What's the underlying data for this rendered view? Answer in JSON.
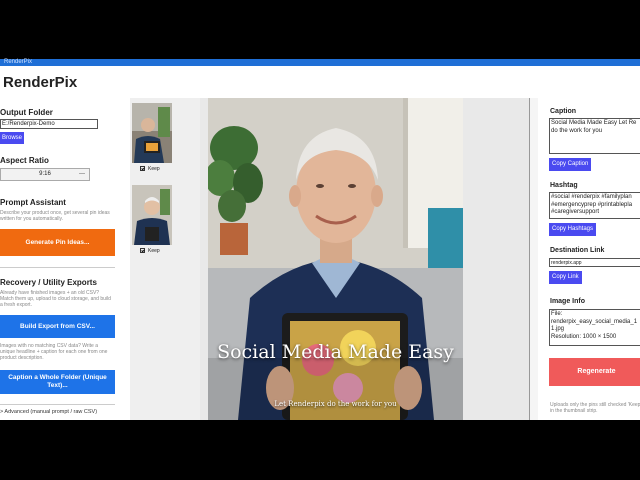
{
  "window": {
    "title_bar_text": "RenderPix",
    "app_title": "RenderPix"
  },
  "left": {
    "output_folder": {
      "label": "Output Folder",
      "path_value": "E:/Renderpix-Demo",
      "browse_label": "Browse"
    },
    "aspect_ratio": {
      "label": "Aspect Ratio",
      "value": "9:16"
    },
    "prompt_assistant": {
      "label": "Prompt Assistant",
      "description": "Describe your product once, get several pin ideas written for you automatically.",
      "generate_label": "Generate Pin Ideas..."
    },
    "recovery": {
      "label": "Recovery / Utility Exports",
      "description_1": "Already have finished images + an old CSV? Match them up, upload to cloud storage, and build a fresh export.",
      "build_export_label": "Build Export from CSV...",
      "description_2": "Images with no matching CSV data? Write a unique headline + caption for each one from one product description.",
      "caption_folder_label": "Caption a Whole Folder (Unique Text)..."
    },
    "advanced_label": "> Advanced (manual prompt / raw CSV)"
  },
  "thumbnails": [
    {
      "keep_label": "Keep",
      "checked": true
    },
    {
      "keep_label": "Keep",
      "checked": true
    }
  ],
  "preview": {
    "headline": "Social Media Made Easy",
    "subline": "Let Renderpix do the work for you"
  },
  "right": {
    "caption": {
      "label": "Caption",
      "value": "Social Media Made Easy Let Re\ndo the work for you",
      "copy_label": "Copy Caption"
    },
    "hashtags": {
      "label": "Hashtag",
      "value": "#social #renderpix #familyplan\n#emergencyprep #printablepla\n#caregiversupport",
      "copy_label": "Copy Hashtags"
    },
    "destination": {
      "label": "Destination Link",
      "value": "renderpix.app",
      "copy_label": "Copy Link"
    },
    "image_info": {
      "label": "Image Info",
      "value": "File:\nrenderpix_easy_social_media_1\n1.jpg\nResolution: 1000 × 1500"
    },
    "regenerate_label": "Regenerate",
    "note": "Uploads only the pins still checked 'Keep' in the thumbnail strip."
  },
  "colors": {
    "accent_blue": "#1e73e8",
    "accent_orange": "#f06a10",
    "regenerate_red": "#f05a5a",
    "button_purple": "#4a4af0"
  }
}
